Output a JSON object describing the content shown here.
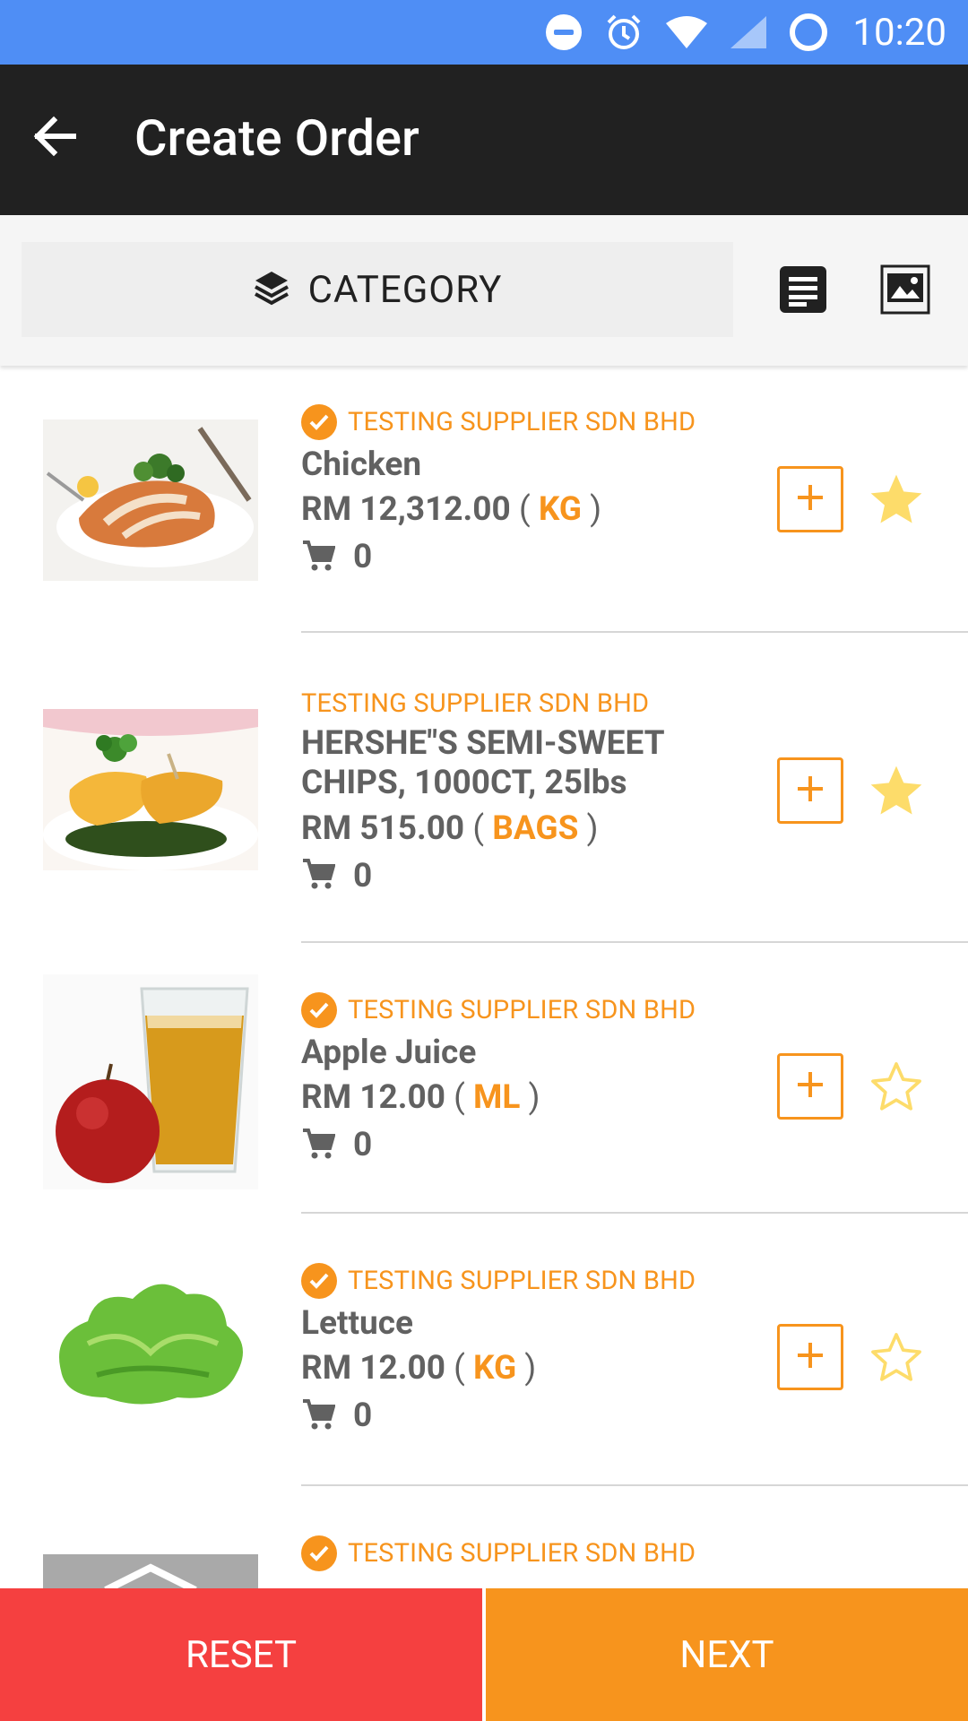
{
  "status_bar": {
    "time": "10:20"
  },
  "app_bar": {
    "title": "Create Order"
  },
  "toolbar": {
    "category_label": "CATEGORY"
  },
  "items": [
    {
      "supplier": "TESTING SUPPLIER SDN BHD",
      "verified": true,
      "name": "Chicken",
      "price": "RM 12,312.00",
      "unit": "KG",
      "qty": "0",
      "favorite": true,
      "image": "roast-chicken"
    },
    {
      "supplier": "TESTING SUPPLIER SDN BHD",
      "verified": false,
      "name": "HERSHE\"S SEMI-SWEET CHIPS, 1000CT, 25lbs",
      "price": "RM 515.00",
      "unit": "BAGS",
      "qty": "0",
      "favorite": true,
      "image": "grilled-corn"
    },
    {
      "supplier": "TESTING SUPPLIER SDN BHD",
      "verified": true,
      "name": "Apple Juice",
      "price": "RM 12.00",
      "unit": "ML",
      "qty": "0",
      "favorite": false,
      "image": "apple-juice"
    },
    {
      "supplier": "TESTING SUPPLIER SDN BHD",
      "verified": true,
      "name": "Lettuce",
      "price": "RM 12.00",
      "unit": "KG",
      "qty": "0",
      "favorite": false,
      "image": "lettuce"
    },
    {
      "supplier": "TESTING SUPPLIER SDN BHD",
      "verified": true,
      "name": "",
      "price": "",
      "unit": "",
      "qty": "",
      "favorite": false,
      "image": "placeholder"
    }
  ],
  "bottom": {
    "reset_label": "RESET",
    "next_label": "NEXT"
  },
  "colors": {
    "status_bar": "#4f8ef5",
    "app_bar": "#212121",
    "accent": "#f7941d",
    "reset": "#f54040",
    "star": "#fddc6a"
  }
}
